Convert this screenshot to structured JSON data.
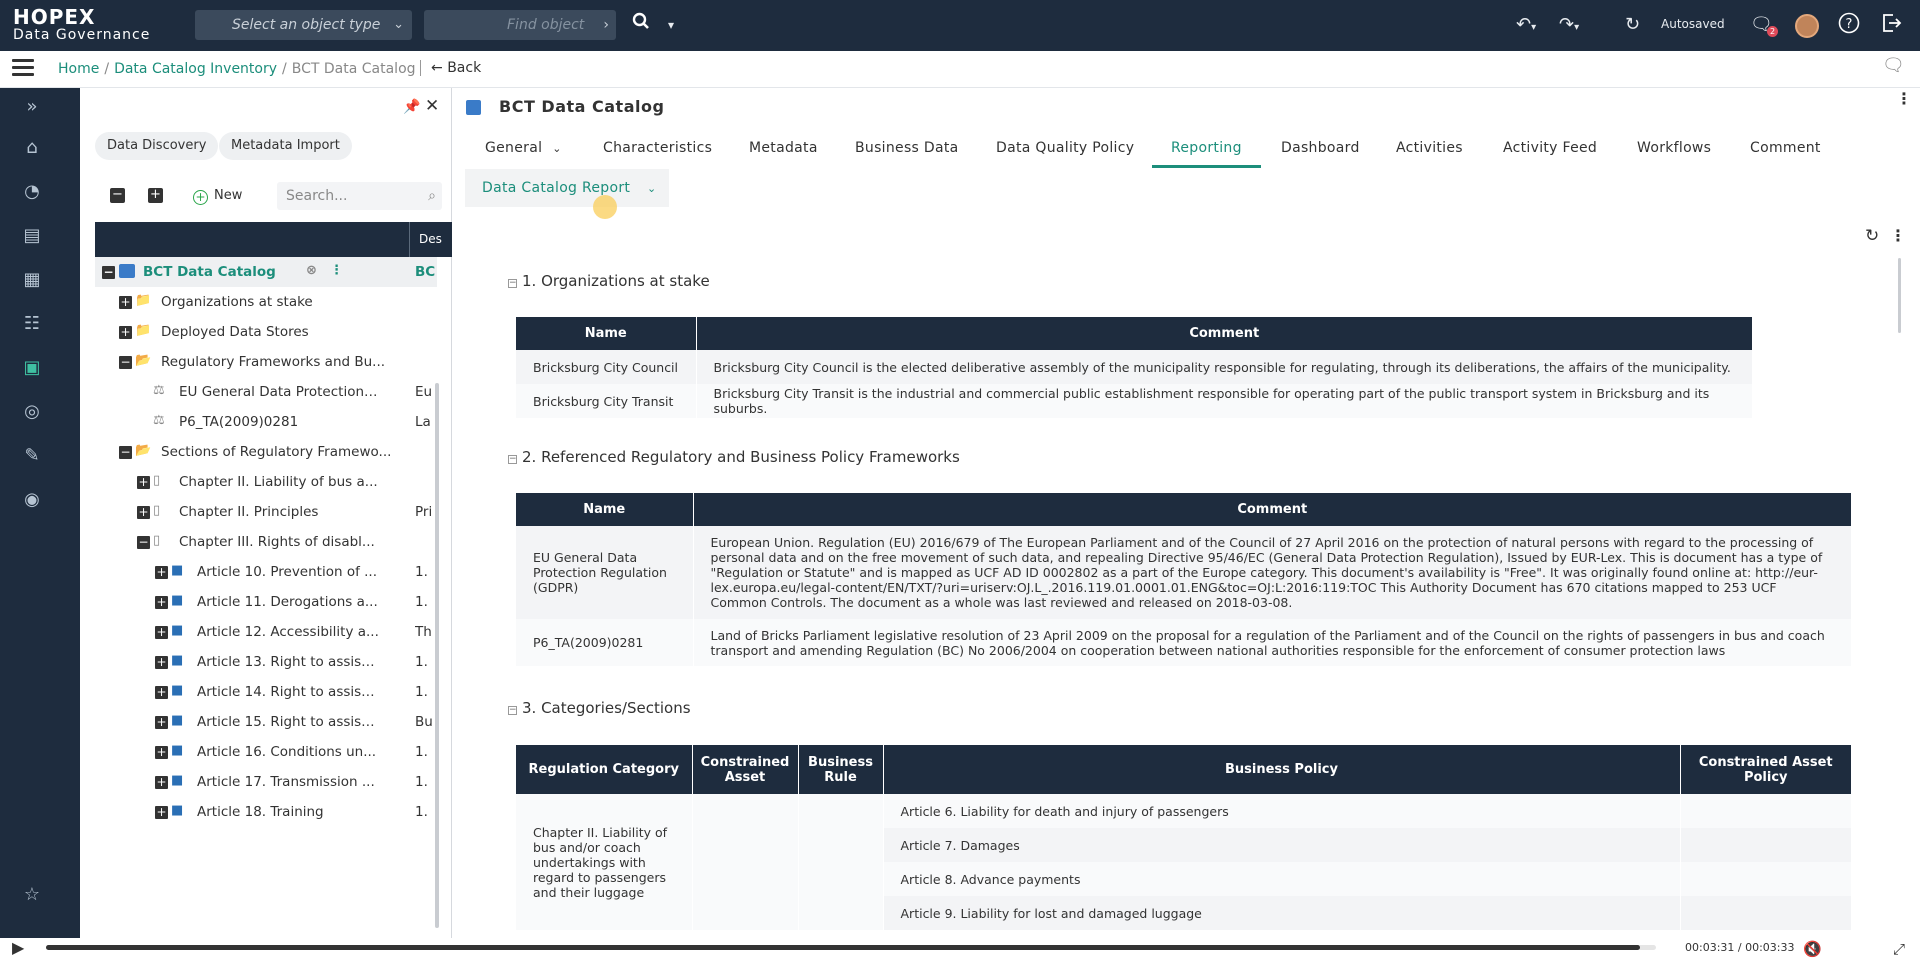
{
  "app": {
    "brand_top": "HOPEX",
    "brand_bottom": "Data Governance"
  },
  "topbar": {
    "object_type_placeholder": "Select an object type",
    "find_placeholder": "Find object",
    "autosaved": "Autosaved",
    "notif_count": "2"
  },
  "breadcrumb": {
    "home": "Home",
    "inventory": "Data Catalog Inventory",
    "current": "BCT Data Catalog",
    "back": "Back"
  },
  "panel": {
    "data_discovery": "Data Discovery",
    "metadata_import": "Metadata Import",
    "new_label": "New",
    "search_placeholder": "Search...",
    "desc_header": "Des",
    "tree": [
      {
        "label": "BCT Data Catalog",
        "desc": "BC"
      },
      {
        "label": "Organizations at stake",
        "desc": ""
      },
      {
        "label": "Deployed Data Stores",
        "desc": ""
      },
      {
        "label": "Regulatory Frameworks and Bu...",
        "desc": ""
      },
      {
        "label": "EU General Data Protection ...",
        "desc": "Eu"
      },
      {
        "label": "P6_TA(2009)0281",
        "desc": "La"
      },
      {
        "label": "Sections of Regulatory Framewo...",
        "desc": ""
      },
      {
        "label": "Chapter II. Liability of bus a...",
        "desc": ""
      },
      {
        "label": "Chapter II. Principles",
        "desc": "Pri"
      },
      {
        "label": "Chapter III. Rights of disabl...",
        "desc": ""
      },
      {
        "label": "Article 10. Prevention of ...",
        "desc": "1."
      },
      {
        "label": "Article 11. Derogations a...",
        "desc": "1."
      },
      {
        "label": "Article 12. Accessibility a...",
        "desc": "Th"
      },
      {
        "label": "Article 13. Right to assist...",
        "desc": "1."
      },
      {
        "label": "Article 14. Right to assist...",
        "desc": "1."
      },
      {
        "label": "Article 15. Right to assist...",
        "desc": "Bu"
      },
      {
        "label": "Article 16. Conditions un...",
        "desc": "1."
      },
      {
        "label": "Article 17. Transmission ...",
        "desc": "1."
      },
      {
        "label": "Article 18. Training",
        "desc": "1."
      }
    ]
  },
  "main": {
    "title": "BCT Data Catalog",
    "tabs": [
      "General",
      "Characteristics",
      "Metadata",
      "Business Data",
      "Data Quality Policy",
      "Reporting",
      "Dashboard",
      "Activities",
      "Activity Feed",
      "Workflows",
      "Comment"
    ],
    "active_tab": "Reporting",
    "report_tab": "Data Catalog Report"
  },
  "report": {
    "s1_title": "1. Organizations at stake",
    "s1_headers": [
      "Name",
      "Comment"
    ],
    "s1_rows": [
      {
        "name": "Bricksburg City Council",
        "comment": "Bricksburg City Council is the elected deliberative assembly of the municipality responsible for regulating, through its deliberations, the affairs of the municipality."
      },
      {
        "name": "Bricksburg City Transit",
        "comment": "Bricksburg City Transit is the industrial and commercial public establishment responsible for operating part of the public transport system in Bricksburg and its suburbs."
      }
    ],
    "s2_title": "2. Referenced Regulatory and Business Policy Frameworks",
    "s2_headers": [
      "Name",
      "Comment"
    ],
    "s2_rows": [
      {
        "name": "EU General Data Protection Regulation (GDPR)",
        "comment": "European Union. Regulation (EU) 2016/679 of The European Parliament and of the Council of 27 April 2016 on the protection of natural persons with regard to the processing of personal data and on the free movement of such data, and repealing Directive 95/46/EC (General Data Protection Regulation), Issued by EUR-Lex. This is document has a type of \"Regulation or Statute\" and is mapped as UCF AD ID 0002802 as a part of the Europe category. This document's availability is \"Free\". It was originally found online at: http://eur-lex.europa.eu/legal-content/EN/TXT/?uri=uriserv:OJ.L_.2016.119.01.0001.01.ENG&toc=OJ:L:2016:119:TOC This Authority Document has 670 citations mapped to 253 UCF Common Controls. The document as a whole was last reviewed and released on 2018-03-08."
      },
      {
        "name": "P6_TA(2009)0281",
        "comment": "Land of Bricks Parliament legislative resolution of 23 April 2009 on the proposal for a regulation of the Parliament and of the Council on the rights of passengers in bus and coach transport and amending Regulation (BC) No 2006/2004 on cooperation between national authorities responsible for the enforcement of consumer protection laws"
      }
    ],
    "s3_title": "3. Categories/Sections",
    "s3_headers": [
      "Regulation Category",
      "Constrained Asset",
      "Business Rule",
      "Business Policy",
      "Constrained Asset Policy"
    ],
    "s3_category": "Chapter II. Liability of bus and/or coach undertakings with regard to passengers and their luggage",
    "s3_policies": [
      "Article 6. Liability for death and injury of passengers",
      "Article 7. Damages",
      "Article 8. Advance payments",
      "Article 9. Liability for lost and damaged luggage"
    ]
  },
  "player": {
    "time": "00:03:31 / 00:03:33",
    "progress": 0.99
  }
}
